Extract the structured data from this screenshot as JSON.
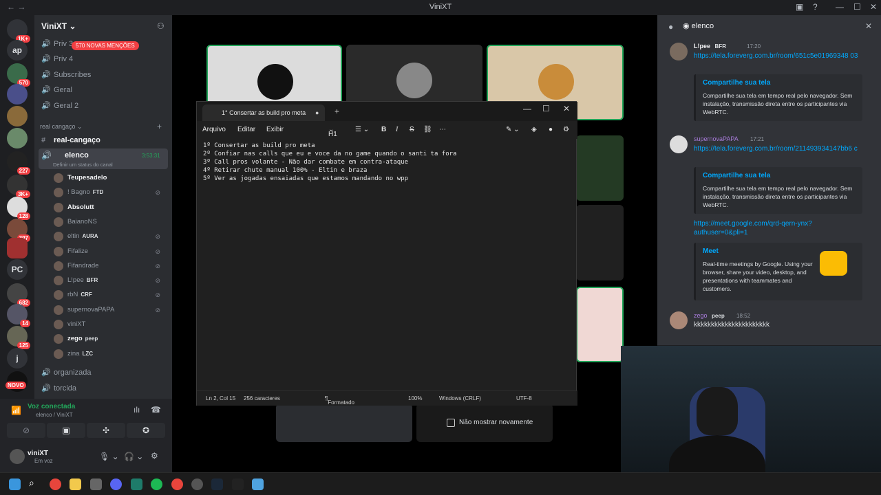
{
  "window": {
    "title": "ViniXT"
  },
  "server": {
    "name": "ViniXT",
    "mentions_badge": "570 NOVAS MENÇÕES"
  },
  "rail": {
    "badges": [
      "1K+",
      "570",
      "227",
      "3K+",
      "128",
      "397",
      "682",
      "14",
      "125",
      "NOVO"
    ],
    "text_servers": [
      "ap",
      "PC",
      "j"
    ]
  },
  "channels": {
    "voice_top": [
      "Priv 3",
      "Priv 4",
      "Subscribes",
      "Geral",
      "Geral 2"
    ],
    "category": "real cangaço",
    "text_channel": "real-cangaço",
    "active_voice": {
      "name": "elenco",
      "timer": "3:53:31",
      "status": "Definir um status do canal"
    },
    "members": [
      {
        "name": "Teupesadelo",
        "tag": "",
        "bold": true
      },
      {
        "name": "! Bagno",
        "tag": "FTD",
        "bold": false
      },
      {
        "name": "Absolutt",
        "tag": "",
        "bold": true
      },
      {
        "name": "BaianoNS",
        "tag": "",
        "bold": false
      },
      {
        "name": "eltin",
        "tag": "AURA",
        "bold": false
      },
      {
        "name": "Fifalize",
        "tag": "",
        "bold": false
      },
      {
        "name": "Fifandrade",
        "tag": "",
        "bold": false
      },
      {
        "name": "L!pee",
        "tag": "BFR",
        "bold": false
      },
      {
        "name": "rbN",
        "tag": "CRF",
        "bold": false
      },
      {
        "name": "supernovaPAPA",
        "tag": "",
        "bold": false
      },
      {
        "name": "viniXT",
        "tag": "",
        "bold": false
      },
      {
        "name": "zego",
        "tag": "peep",
        "bold": true
      },
      {
        "name": "zina",
        "tag": "LZC",
        "bold": false
      }
    ],
    "after": [
      "organizada",
      "torcida"
    ]
  },
  "voice_panel": {
    "status": "Voz conectada",
    "location": "elenco / ViniXT",
    "user": "viniXT",
    "user_status": "Em voz"
  },
  "notepad": {
    "tab_title": "1° Consertar as build pro meta",
    "menu": [
      "Arquivo",
      "Editar",
      "Exibir"
    ],
    "heading": "H1",
    "lines": [
      "1º Consertar as build pro meta",
      "2º Confiar nas calls que eu e voce da no game quando o santi ta fora",
      "3º Call pros volante - Não dar combate em contra-ataque",
      "4º Retirar chute manual 100% - Eltin e braza",
      "5º Ver as jogadas ensaiadas que estamos mandando no wpp"
    ],
    "status": {
      "position": "Ln 2, Col 15",
      "chars": "256 caracteres",
      "format": "Formatado",
      "zoom": "100%",
      "eol": "Windows (CRLF)",
      "encoding": "UTF-8"
    }
  },
  "popup": {
    "checkbox_label": "Não mostrar novamente"
  },
  "right_panel": {
    "channel": "elenco",
    "messages": [
      {
        "author": "L!pee",
        "tag": "BFR",
        "time": "17:20",
        "link": "https://tela.foreverg.com.br/room/651c5e01969348 03",
        "embed_title": "Compartilhe sua tela",
        "embed_desc": "Compartilhe sua tela em tempo real pelo navegador. Sem instalação, transmissão direta entre os participantes via WebRTC."
      },
      {
        "author": "supernovaPAPA",
        "tag": "",
        "time": "17:21",
        "link": "https://tela.foreverg.com.br/room/211493934147bb6 c",
        "embed_title": "Compartilhe sua tela",
        "embed_desc": "Compartilhe sua tela em tempo real pelo navegador. Sem instalação, transmissão direta entre os participantes via WebRTC.",
        "link2": "https://meet.google.com/qrd-qern-ynx?authuser=0&pli=1",
        "embed2_title": "Meet",
        "embed2_desc": "Real-time meetings by Google. Using your browser, share your video, desktop, and presentations with teammates and customers."
      },
      {
        "author": "zego",
        "tag": "peep",
        "time": "18:52",
        "text": "kkkkkkkkkkkkkkkkkkkkkk"
      }
    ]
  }
}
